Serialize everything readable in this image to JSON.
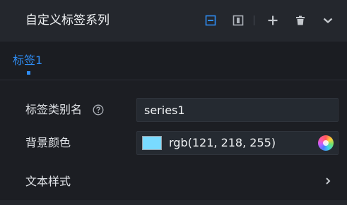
{
  "header": {
    "title": "自定义标签系列",
    "icons": [
      "collapse-all-icon",
      "split-panel-icon",
      "plus-icon",
      "trash-icon",
      "chevron-down-icon"
    ]
  },
  "tabs": [
    {
      "label": "标签1",
      "active": true
    }
  ],
  "form": {
    "series_name": {
      "label": "标签类别名",
      "help_icon": "question-circle-icon",
      "value": "series1"
    },
    "background_color": {
      "label": "背景颜色",
      "value": "rgb(121, 218, 255)",
      "swatch": "#79daff"
    },
    "text_style": {
      "label": "文本样式",
      "icon": "chevron-right-icon"
    }
  },
  "colors": {
    "accent": "#2f8df4",
    "header_bg": "#24272d",
    "panel_bg": "#1c1e23",
    "input_bg": "#252a31"
  }
}
